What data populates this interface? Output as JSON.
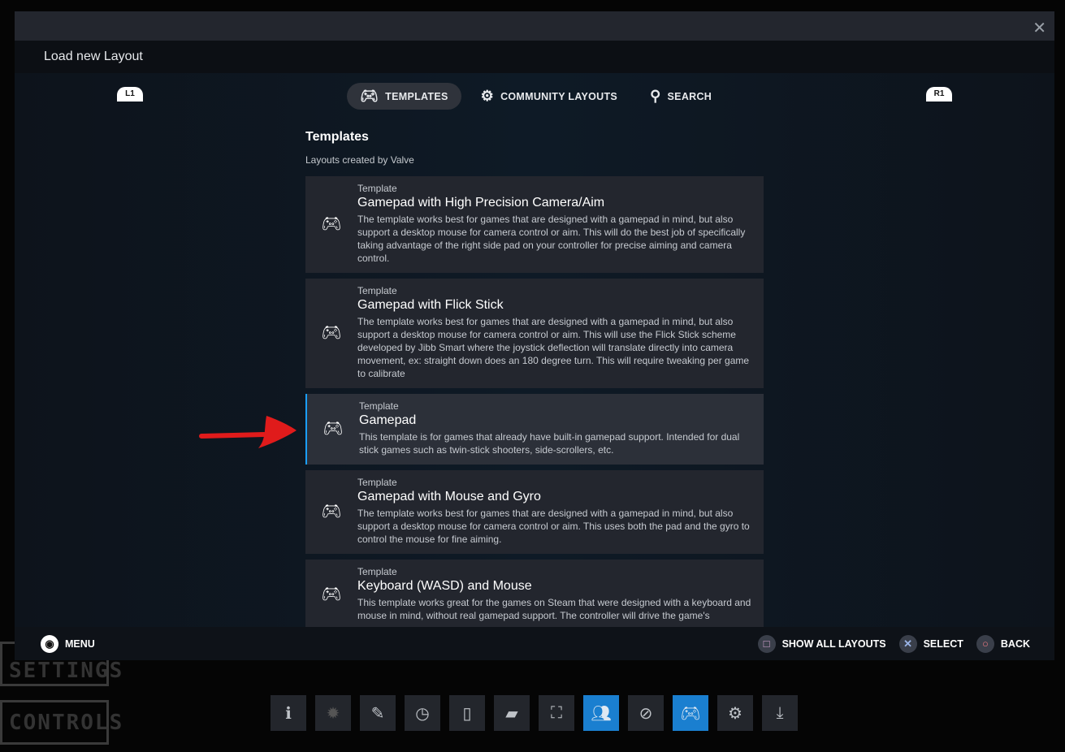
{
  "dialog": {
    "title": "Load new Layout",
    "close_icon": "close-icon"
  },
  "shoulders": {
    "left": "L1",
    "right": "R1"
  },
  "tabs": [
    {
      "label": "TEMPLATES",
      "icon": "gamepad-icon",
      "active": true
    },
    {
      "label": "COMMUNITY LAYOUTS",
      "icon": "steam-icon"
    },
    {
      "label": "SEARCH",
      "icon": "search-icon"
    }
  ],
  "section": {
    "title": "Templates",
    "subtitle": "Layouts created by Valve"
  },
  "templates": [
    {
      "kind": "Template",
      "title": "Gamepad with High Precision Camera/Aim",
      "desc": "The template works best for games that are designed with a gamepad in mind, but also support a desktop mouse for camera control or aim. This will do the best job of specifically taking advantage of the right side pad on your controller for precise aiming and camera control."
    },
    {
      "kind": "Template",
      "title": "Gamepad with Flick Stick",
      "desc": "The template works best for games that are designed with a gamepad in mind, but also support a desktop mouse for camera control or aim. This will use the Flick Stick scheme developed by Jibb Smart where the joystick deflection will translate directly into camera movement, ex: straight down does an 180 degree turn. This will require tweaking per game to calibrate"
    },
    {
      "kind": "Template",
      "title": "Gamepad",
      "desc": "This template is for games that already have built-in gamepad support. Intended for dual stick games such as twin-stick shooters, side-scrollers, etc.",
      "selected": true
    },
    {
      "kind": "Template",
      "title": "Gamepad with Mouse and Gyro",
      "desc": "The template works best for games that are designed with a gamepad in mind, but also support a desktop mouse for camera control or aim. This uses both the pad and the gyro to control the mouse for fine aiming."
    },
    {
      "kind": "Template",
      "title": "Keyboard (WASD) and Mouse",
      "desc": "This template works great for the games on Steam that were designed with a keyboard and mouse in mind, without real gamepad support. The controller will drive the game's"
    }
  ],
  "footer": {
    "menu": "MENU",
    "show_all": "SHOW ALL LAYOUTS",
    "select": "SELECT",
    "back": "BACK"
  },
  "background": {
    "settings": "SETTINGS",
    "controls": "CONTROLS"
  },
  "dock": [
    "info-icon",
    "gear-badge-icon",
    "pencil-icon",
    "history-icon",
    "guide-icon",
    "chat-icon",
    "screenshot-icon",
    "friends-icon",
    "compass-icon",
    "controller-icon",
    "settings-icon",
    "download-icon"
  ],
  "colors": {
    "accent": "#1a9fff",
    "dock_active": "#1a7fd0",
    "arrow": "#e01b1b"
  }
}
